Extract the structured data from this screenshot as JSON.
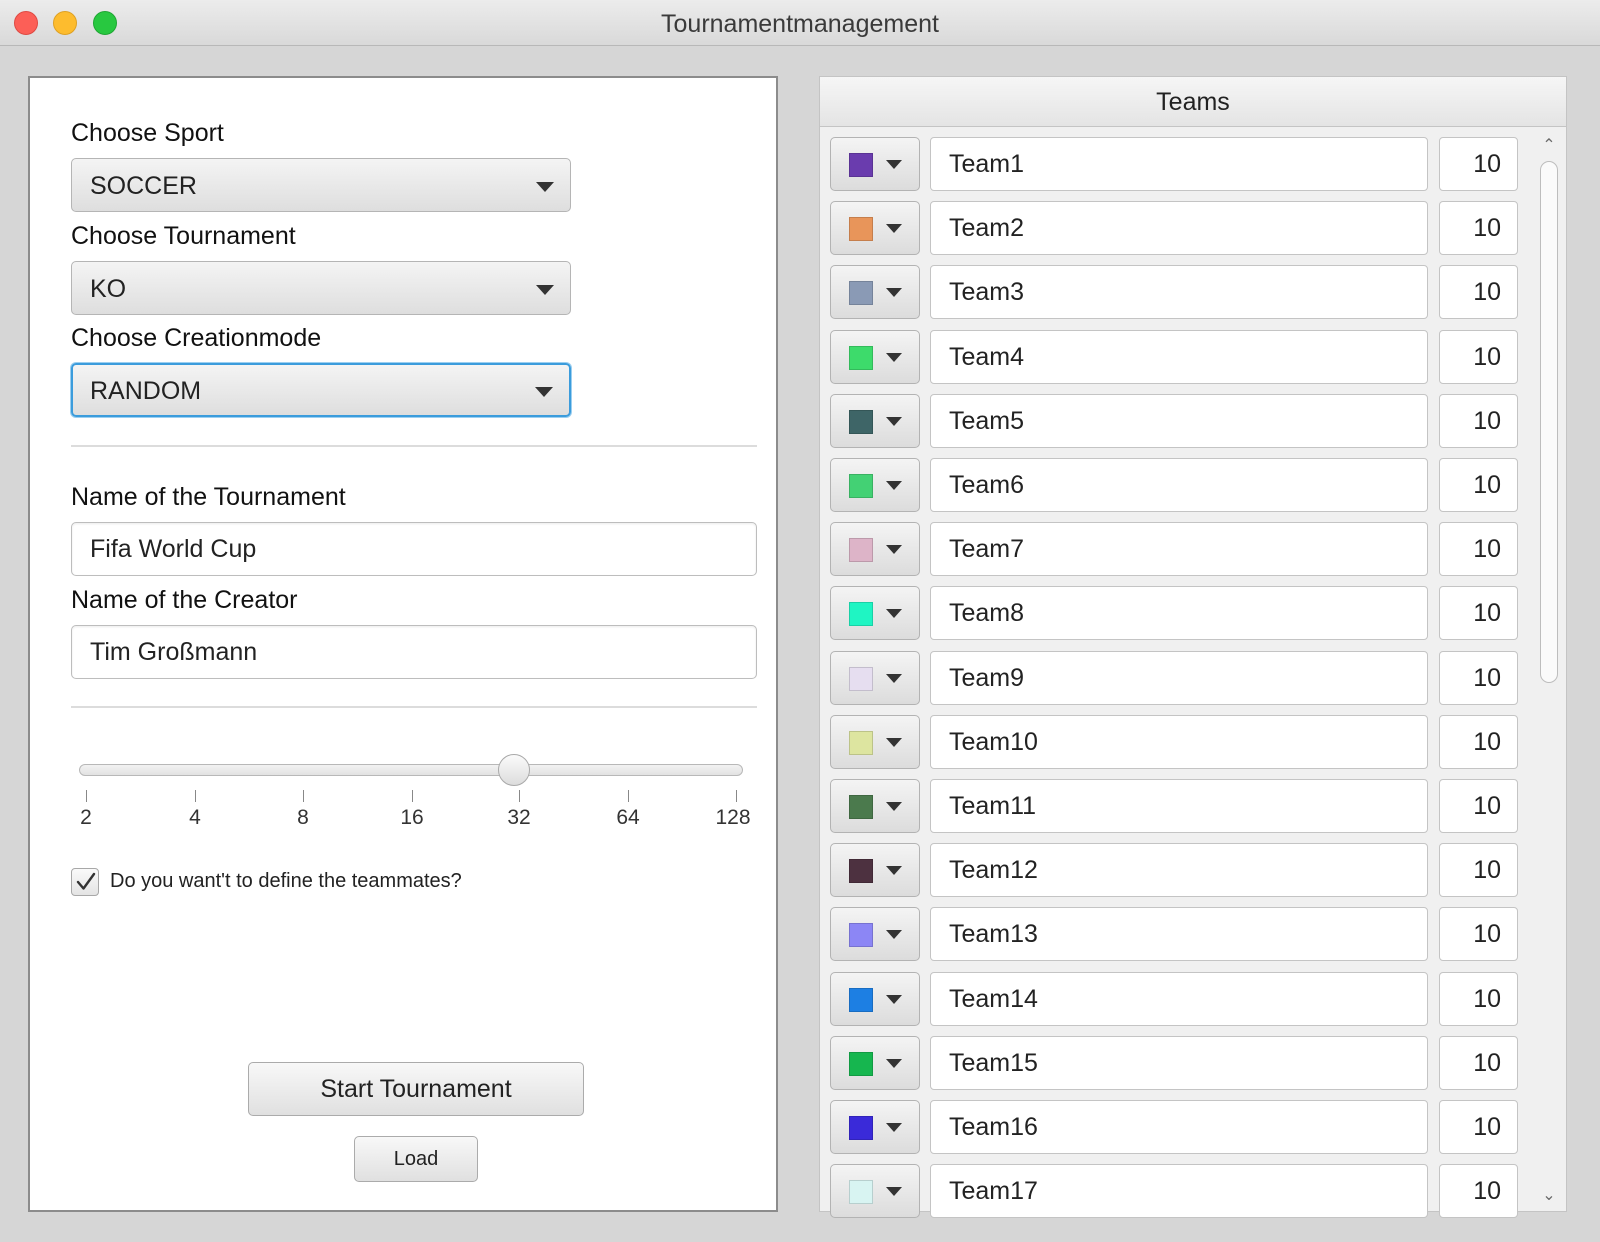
{
  "window": {
    "title": "Tournamentmanagement"
  },
  "form": {
    "sport_label": "Choose Sport",
    "sport_value": "SOCCER",
    "tournament_label": "Choose Tournament",
    "tournament_value": "KO",
    "creationmode_label": "Choose Creationmode",
    "creationmode_value": "RANDOM",
    "tournament_name_label": "Name of the Tournament",
    "tournament_name_value": "Fifa World Cup",
    "creator_label": "Name of the Creator",
    "creator_value": "Tim Großmann",
    "slider": {
      "ticks": [
        "2",
        "4",
        "8",
        "16",
        "32",
        "64",
        "128"
      ],
      "selected": "32"
    },
    "checkbox_label": "Do you want't to define the teammates?",
    "checkbox_checked": true,
    "start_button": "Start Tournament",
    "load_button": "Load"
  },
  "teams": {
    "header": "Teams",
    "rows": [
      {
        "name": "Team1",
        "value": "10",
        "color": "#6a3cae"
      },
      {
        "name": "Team2",
        "value": "10",
        "color": "#e8955a"
      },
      {
        "name": "Team3",
        "value": "10",
        "color": "#8a9ab5"
      },
      {
        "name": "Team4",
        "value": "10",
        "color": "#3ddb6b"
      },
      {
        "name": "Team5",
        "value": "10",
        "color": "#3e6567"
      },
      {
        "name": "Team6",
        "value": "10",
        "color": "#43d174"
      },
      {
        "name": "Team7",
        "value": "10",
        "color": "#ddb4c8"
      },
      {
        "name": "Team8",
        "value": "10",
        "color": "#1ff5c3"
      },
      {
        "name": "Team9",
        "value": "10",
        "color": "#e6def0"
      },
      {
        "name": "Team10",
        "value": "10",
        "color": "#dde5a0"
      },
      {
        "name": "Team11",
        "value": "10",
        "color": "#4b7a4d"
      },
      {
        "name": "Team12",
        "value": "10",
        "color": "#4d3140"
      },
      {
        "name": "Team13",
        "value": "10",
        "color": "#8c86f5"
      },
      {
        "name": "Team14",
        "value": "10",
        "color": "#1d7fe3"
      },
      {
        "name": "Team15",
        "value": "10",
        "color": "#16b64f"
      },
      {
        "name": "Team16",
        "value": "10",
        "color": "#3a2ad9"
      },
      {
        "name": "Team17",
        "value": "10",
        "color": "#d8f4f2"
      }
    ]
  }
}
